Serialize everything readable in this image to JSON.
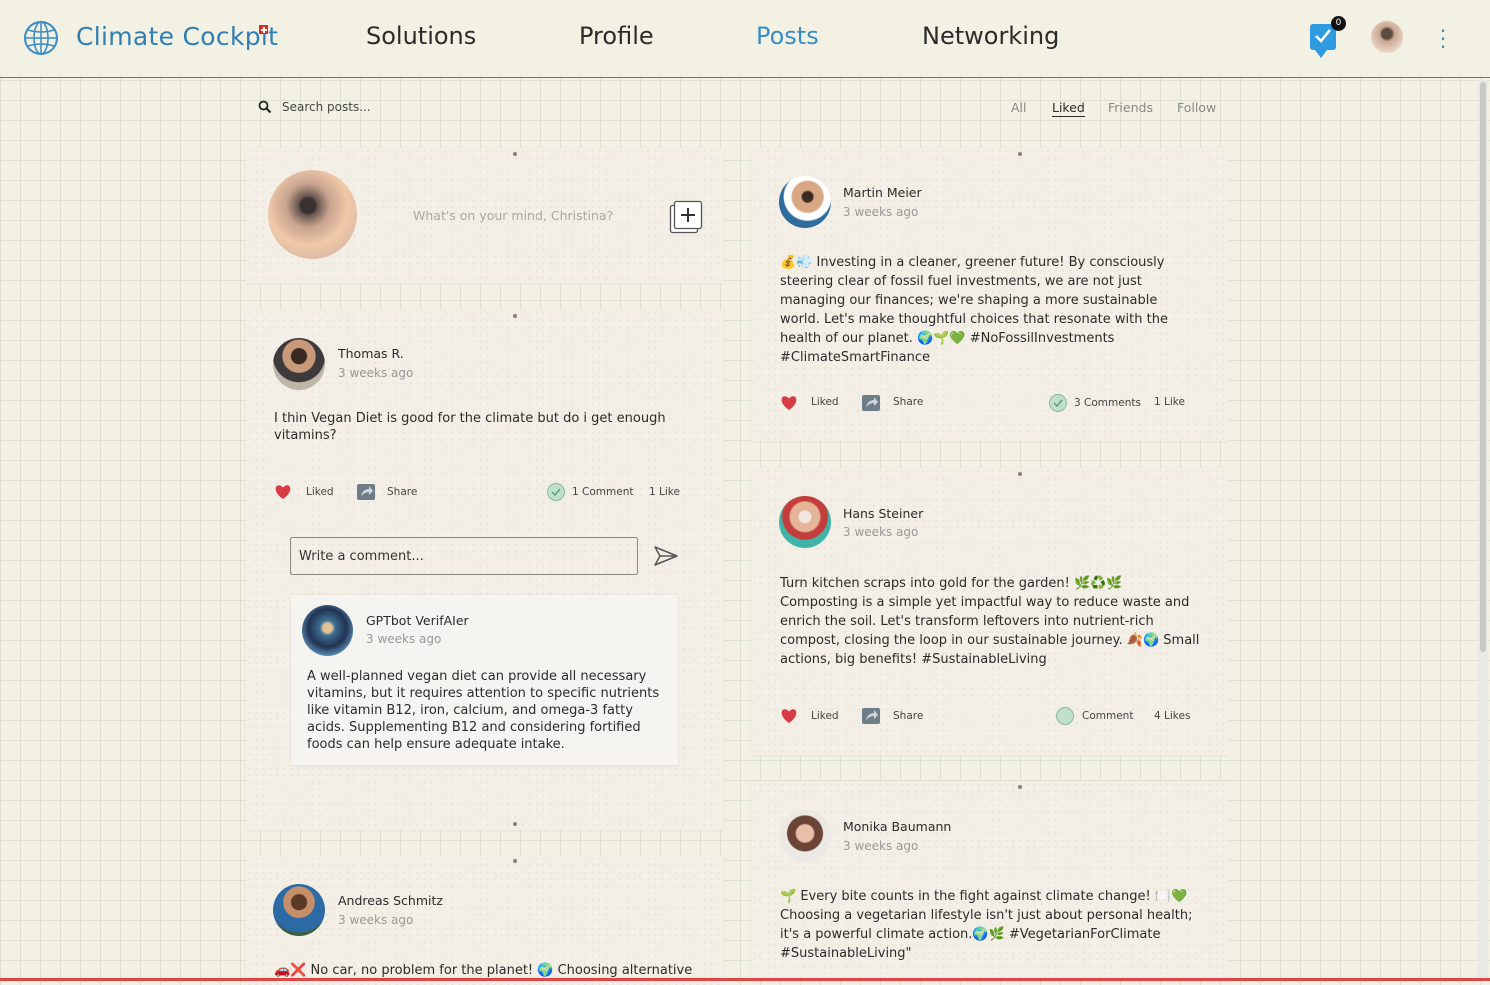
{
  "header": {
    "brand": "Climate Cockpit",
    "nav": [
      "Solutions",
      "Profile",
      "Posts",
      "Networking"
    ],
    "active_nav": "Posts",
    "notification_count": "0",
    "accent_color": "#3a8cc4"
  },
  "search": {
    "placeholder": "Search posts..."
  },
  "filters": [
    "All",
    "Liked",
    "Friends",
    "Follow"
  ],
  "active_filter": "Liked",
  "composer": {
    "placeholder": "What's on your mind, Christina?"
  },
  "actions": {
    "liked": "Liked",
    "share": "Share"
  },
  "posts": [
    {
      "author": "Thomas R.",
      "time": "3 weeks ago",
      "text": "I thin Vegan Diet is good for the climate but do i get enough vitamins?",
      "comments": "1 Comment",
      "likes": "1 Like",
      "comment_input_placeholder": "Write a comment...",
      "reply": {
        "author": "GPTbot VerifAIer",
        "time": "3 weeks ago",
        "text": "A well-planned vegan diet can provide all necessary vitamins, but it requires attention to specific nutrients like vitamin B12, iron, calcium, and omega-3 fatty acids. Supplementing B12 and considering fortified foods can help ensure adequate intake."
      }
    },
    {
      "author": "Andreas Schmitz",
      "time": "3 weeks ago",
      "text": "🚗❌ No car, no problem for the planet! 🌍 Choosing alternative"
    },
    {
      "author": "Martin Meier",
      "time": "3 weeks ago",
      "text": "💰💨 Investing in a cleaner, greener future! By consciously steering clear of fossil fuel investments, we are not just managing our finances; we're shaping a more sustainable world. Let's make thoughtful choices that resonate with the health of our planet. 🌍🌱💚 #NoFossilInvestments #ClimateSmartFinance",
      "comments": "3 Comments",
      "likes": "1 Like"
    },
    {
      "author": "Hans Steiner",
      "time": "3 weeks ago",
      "text": "Turn kitchen scraps into gold for the garden! 🌿♻️🌿 Composting is a simple yet impactful way to reduce waste and enrich the soil. Let's transform leftovers into nutrient-rich compost, closing the loop in our sustainable journey. 🍂🌍 Small actions, big benefits! #SustainableLiving",
      "comments": "Comment",
      "likes": "4 Likes"
    },
    {
      "author": "Monika Baumann",
      "time": "3 weeks ago",
      "text": "🌱 Every bite counts in the fight against climate change! 🍽️💚 Choosing a vegetarian lifestyle isn't just about personal health; it's a powerful climate action.🌍🌿 #VegetarianForClimate #SustainableLiving\""
    }
  ]
}
